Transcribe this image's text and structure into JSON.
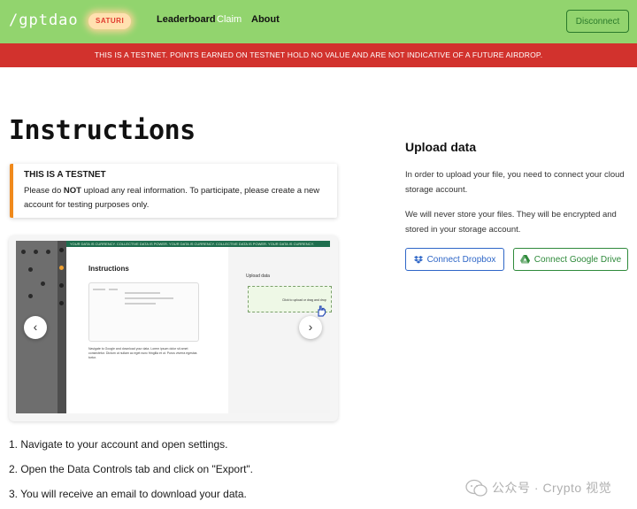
{
  "header": {
    "logo": "/gptdao",
    "badge": "SATURI",
    "nav": {
      "leaderboard": "Leaderboard",
      "claim": "Claim",
      "about": "About"
    },
    "disconnect_label": "Disconnect"
  },
  "banner": {
    "text": "THIS IS A TESTNET. POINTS EARNED ON TESTNET HOLD NO VALUE AND ARE NOT INDICATIVE OF A FUTURE AIRDROP."
  },
  "instructions": {
    "title": "Instructions",
    "notice": {
      "title": "THIS IS A TESTNET",
      "body_prefix": "Please do ",
      "body_bold": "NOT",
      "body_suffix": " upload any real information. To participate, please create a new account for testing purposes only."
    },
    "carousel": {
      "screenshot": {
        "banner_text": "YOUR DATA IS CURRENCY. COLLECTIVE DATA IS POWER. YOUR DATA IS CURRENCY. COLLECTIVE DATA IS POWER. YOUR DATA IS CURRENCY.",
        "title": "Instructions",
        "caption": "Navigate to Google and download your data. Lorem ipsum dolor sit amet consectetur. Dictum ut nullam ac eget nunc fringilla et ut. Purus viverra egestas tortor.",
        "upload_label": "Upload data",
        "drop_text": "Click to upload or drag and drop"
      },
      "prev_glyph": "‹",
      "next_glyph": "›"
    },
    "steps": [
      "1. Navigate to your account and open settings.",
      "2. Open the Data Controls tab and click on \"Export\".",
      "3. You will receive an email to download your data."
    ]
  },
  "upload": {
    "title": "Upload data",
    "text1": "In order to upload your file, you need to connect your cloud storage account.",
    "text2": "We will never store your files. They will be encrypted and stored in your storage account.",
    "dropbox_label": "Connect Dropbox",
    "gdrive_label": "Connect Google Drive"
  },
  "watermark": {
    "text": "公众号 · Crypto 视觉"
  },
  "icons": {
    "dropbox": "dropbox-icon",
    "gdrive": "google-drive-icon",
    "prev": "chevron-left-icon",
    "next": "chevron-right-icon"
  },
  "colors": {
    "header": "#92d46e",
    "banner": "#d2322d",
    "notice_accent": "#f08a1c",
    "dropbox": "#2e66c7",
    "gdrive": "#2f8a3b"
  }
}
